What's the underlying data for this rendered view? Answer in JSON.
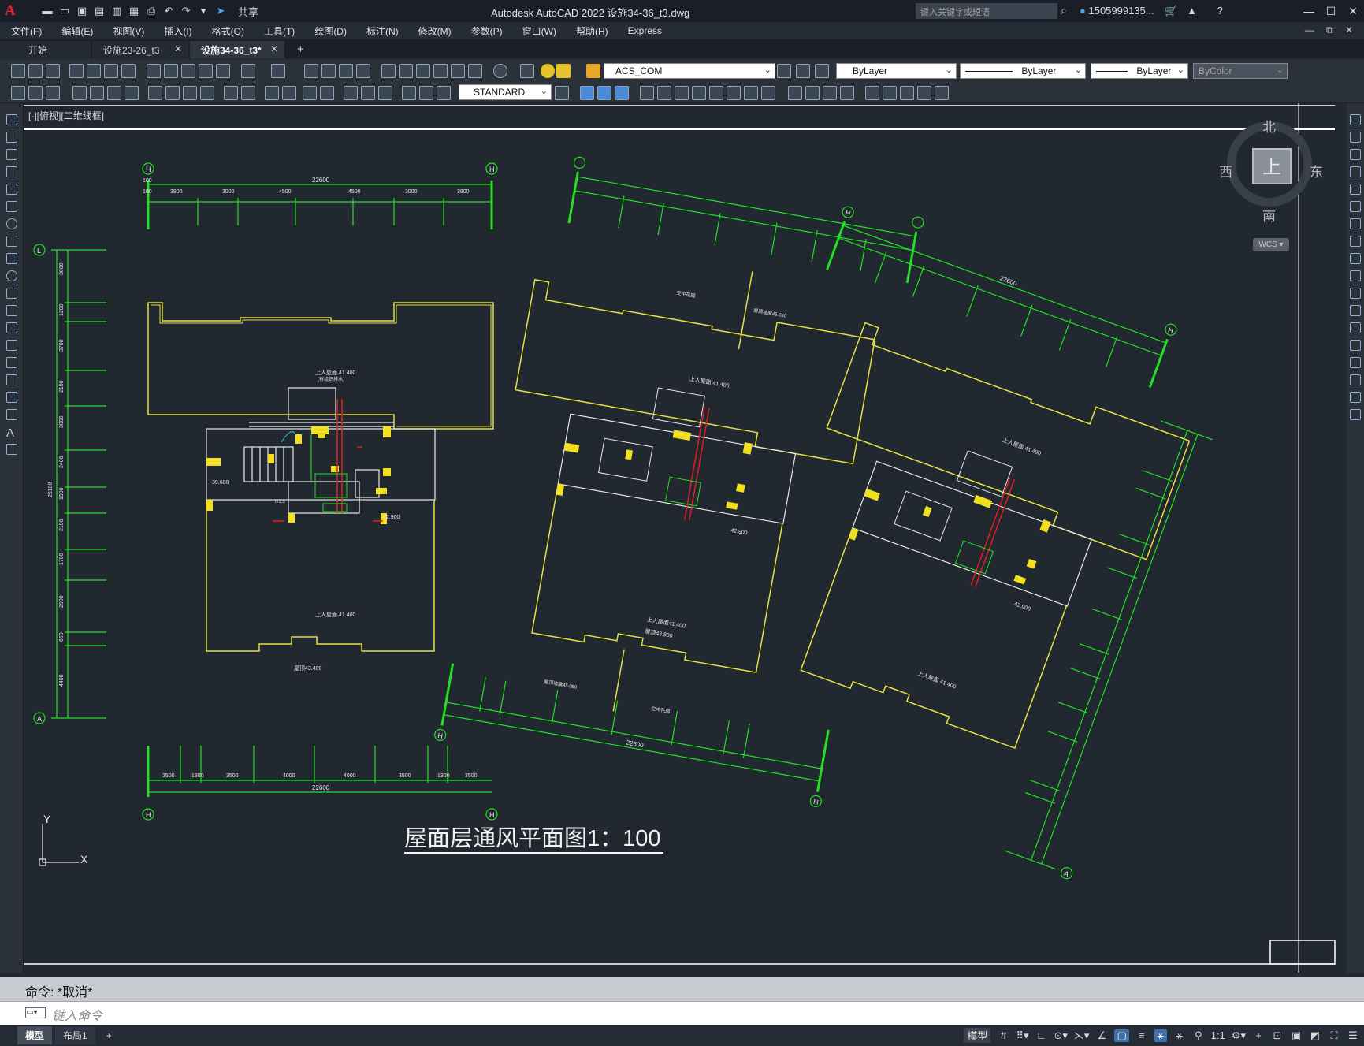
{
  "app": {
    "logo": "A",
    "title": "Autodesk AutoCAD 2022    设施34-36_t3.dwg",
    "share_label": "共享",
    "search_placeholder": "键入关键字或短语",
    "user_name": "1505999135...",
    "window_buttons": [
      "—",
      "☐",
      "✕"
    ]
  },
  "menu": {
    "items": [
      "文件(F)",
      "编辑(E)",
      "视图(V)",
      "插入(I)",
      "格式(O)",
      "工具(T)",
      "绘图(D)",
      "标注(N)",
      "修改(M)",
      "参数(P)",
      "窗口(W)",
      "帮助(H)",
      "Express"
    ],
    "doc_controls": "— ⧉ ✕"
  },
  "tabs": {
    "items": [
      {
        "label": "开始",
        "closable": false,
        "active": false
      },
      {
        "label": "设施23-26_t3",
        "closable": true,
        "active": false
      },
      {
        "label": "设施34-36_t3*",
        "closable": true,
        "active": true
      }
    ],
    "add_label": "+"
  },
  "toolbar": {
    "layer_value": "ACS_COM",
    "color_value": "ByLayer",
    "linetype_value": "ByLayer",
    "lineweight_value": "ByLayer",
    "plotstyle_value": "ByColor",
    "textstyle_value": "STANDARD"
  },
  "viewport": {
    "label": "[-][俯视][二维线框]"
  },
  "viewcube": {
    "north": "北",
    "south": "南",
    "west": "西",
    "east": "东",
    "face": "上",
    "wcs": "WCS ▾"
  },
  "drawing": {
    "title": "屋面层通风平面图1：100",
    "grid_labels": {
      "h": "H",
      "l": "L",
      "a": "A"
    },
    "dims_top1": [
      "3800",
      "3000",
      "4500",
      "4500",
      "3000",
      "3800"
    ],
    "dims_top1_total": "22600",
    "dims_bottom1": [
      "2500",
      "1300",
      "3500",
      "4000",
      "4000",
      "3500",
      "1300",
      "2500"
    ],
    "dims_bottom1_total": "22600",
    "dims_left": [
      "3800",
      "1200",
      "3700",
      "2100",
      "3000",
      "2400",
      "1900",
      "2100",
      "1700",
      "2900",
      "650",
      "4400"
    ],
    "dims_left_total": "29100",
    "dims_small": "100",
    "elev_roof": "上人屋面 41.400",
    "elev_roof_sub": "(有组织排水)",
    "elev_43": "屋顶43.400",
    "elev_42": "42.900",
    "elev_39": "39.600",
    "elev_roof2": "上人屋面41.400",
    "elev_roof2_sub": "屋顶43.800",
    "elev_45": "屋顶坡度45.050",
    "label_air": "空中花园",
    "label_stair": "T/1.5"
  },
  "command": {
    "history": "命令:  *取消*",
    "placeholder": "键入命令"
  },
  "status": {
    "tabs": [
      "模型",
      "布局1"
    ],
    "add": "+",
    "model_label": "模型",
    "scale": "1:1"
  }
}
